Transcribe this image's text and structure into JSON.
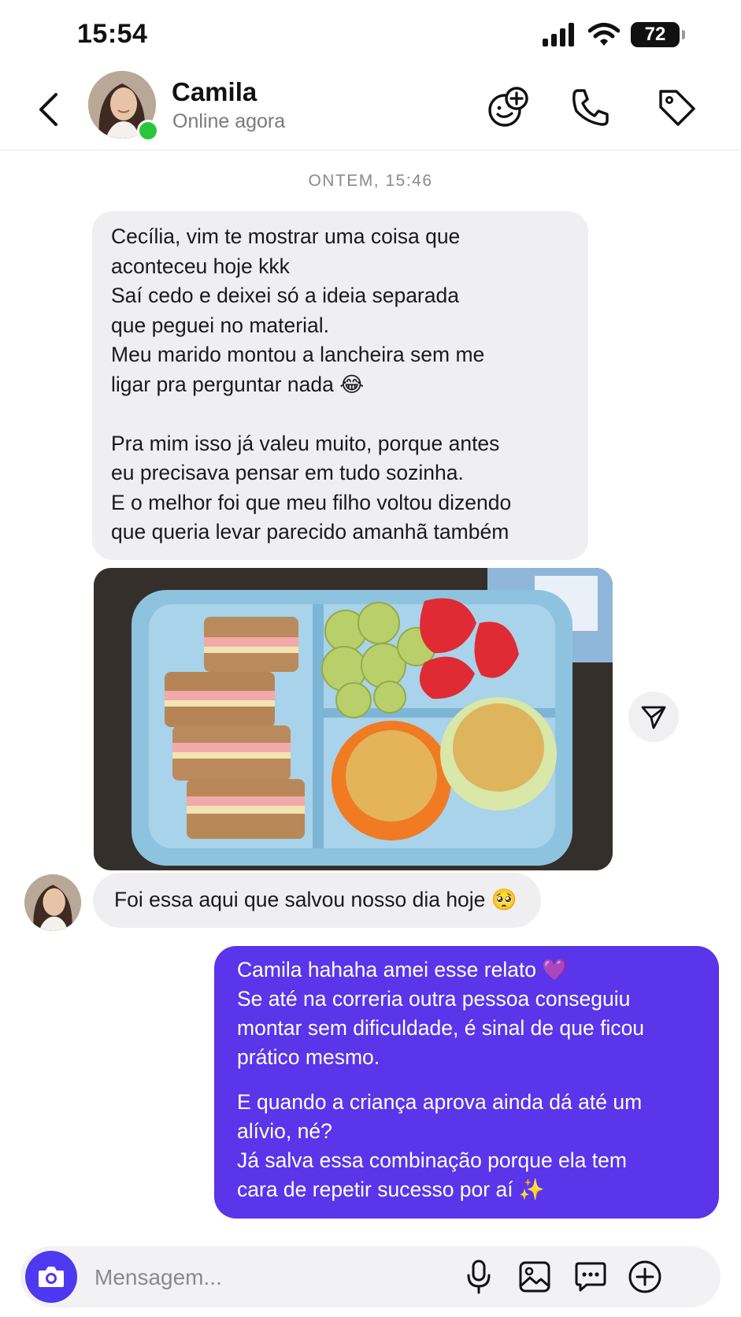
{
  "status_bar": {
    "time": "15:54",
    "battery": "72"
  },
  "header": {
    "contact_name": "Camila",
    "contact_status": "Online agora",
    "icons": [
      "back-chevron-icon",
      "emoji-add-icon",
      "phone-icon",
      "tag-icon"
    ]
  },
  "thread": {
    "date_separator": "ONTEM, 15:46",
    "incoming_message_1": "Cecília, vim te mostrar uma coisa que\naconteceu hoje kkk\nSaí cedo e deixei só a ideia separada\nque peguei no material.\nMeu marido montou a lancheira sem me\nligar pra perguntar nada 😂\n\nPra mim isso já valeu muito, porque antes\neu precisava pensar em tudo sozinha.\nE o melhor foi que meu filho voltou dizendo\nque queria levar parecido amanhã também",
    "incoming_message_2": "Foi essa aqui que salvou nosso dia hoje 🥺",
    "outgoing_paragraph_1": "Camila hahaha amei esse relato 💜\nSe até na correria outra pessoa conseguiu\nmontar sem dificuldade, é sinal de que ficou\nprático mesmo.",
    "outgoing_paragraph_2": "E quando a criança aprova ainda dá até um\nalívio, né?\nJá salva essa combinação porque ela tem\ncara de repetir sucesso por aí ✨"
  },
  "composer": {
    "placeholder": "Mensagem...",
    "icons": [
      "camera-icon",
      "microphone-icon",
      "image-icon",
      "sticker-icon",
      "plus-icon"
    ]
  },
  "colors": {
    "accent": "#5a35ea",
    "incoming_bubble": "#efeff1",
    "online": "#29c63c"
  }
}
